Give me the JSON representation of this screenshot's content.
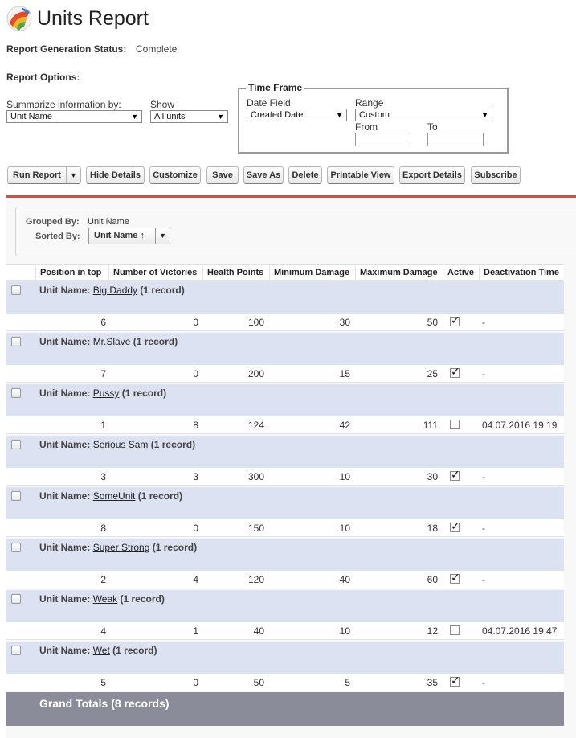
{
  "header": {
    "title": "Units Report",
    "status_label": "Report Generation Status:",
    "status_value": "Complete",
    "options_label": "Report Options:"
  },
  "options": {
    "summarize_label": "Summarize information by:",
    "summarize_value": "Unit Name",
    "show_label": "Show",
    "show_value": "All units",
    "timeframe_legend": "Time Frame",
    "date_field_label": "Date Field",
    "date_field_value": "Created Date",
    "range_label": "Range",
    "range_value": "Custom",
    "from_label": "From",
    "to_label": "To",
    "from_value": "",
    "to_value": ""
  },
  "toolbar": {
    "run_report": "Run Report",
    "hide_details": "Hide Details",
    "customize": "Customize",
    "save": "Save",
    "save_as": "Save As",
    "delete": "Delete",
    "printable_view": "Printable View",
    "export_details": "Export Details",
    "subscribe": "Subscribe"
  },
  "grouping": {
    "grouped_by_label": "Grouped By:",
    "grouped_by_value": "Unit Name",
    "sorted_by_label": "Sorted By:",
    "sorted_by_value": "Unit Name",
    "sort_direction_icon": "arrow-up-icon"
  },
  "table": {
    "columns": [
      "Position in top",
      "Number of Victories",
      "Health Points",
      "Minimum Damage",
      "Maximum Damage",
      "Active",
      "Deactivation Time"
    ],
    "group_prefix": "Unit Name:",
    "groups": [
      {
        "name": "Big Daddy",
        "count": "(1 record)",
        "row": {
          "position": "6",
          "victories": "0",
          "health": "100",
          "min_damage": "30",
          "max_damage": "50",
          "active": true,
          "deactivation": "-"
        }
      },
      {
        "name": "Mr.Slave",
        "count": "(1 record)",
        "row": {
          "position": "7",
          "victories": "0",
          "health": "200",
          "min_damage": "15",
          "max_damage": "25",
          "active": true,
          "deactivation": "-"
        }
      },
      {
        "name": "Pussy",
        "count": "(1 record)",
        "row": {
          "position": "1",
          "victories": "8",
          "health": "124",
          "min_damage": "42",
          "max_damage": "111",
          "active": false,
          "deactivation": "04.07.2016 19:19"
        }
      },
      {
        "name": "Serious Sam",
        "count": "(1 record)",
        "row": {
          "position": "3",
          "victories": "3",
          "health": "300",
          "min_damage": "10",
          "max_damage": "30",
          "active": true,
          "deactivation": "-"
        }
      },
      {
        "name": "SomeUnit",
        "count": "(1 record)",
        "row": {
          "position": "8",
          "victories": "0",
          "health": "150",
          "min_damage": "10",
          "max_damage": "18",
          "active": true,
          "deactivation": "-"
        }
      },
      {
        "name": "Super Strong",
        "count": "(1 record)",
        "row": {
          "position": "2",
          "victories": "4",
          "health": "120",
          "min_damage": "40",
          "max_damage": "60",
          "active": true,
          "deactivation": "-"
        }
      },
      {
        "name": "Weak",
        "count": "(1 record)",
        "row": {
          "position": "4",
          "victories": "1",
          "health": "40",
          "min_damage": "10",
          "max_damage": "12",
          "active": false,
          "deactivation": "04.07.2016 19:47"
        }
      },
      {
        "name": "Wet",
        "count": "(1 record)",
        "row": {
          "position": "5",
          "victories": "0",
          "health": "50",
          "min_damage": "5",
          "max_damage": "35",
          "active": true,
          "deactivation": "-"
        }
      }
    ],
    "grand_totals": "Grand Totals (8 records)"
  },
  "colors": {
    "accent_line": "#c0584a",
    "group_row_bg": "#dde2f2",
    "grand_totals_bg": "#8a8c9a"
  }
}
